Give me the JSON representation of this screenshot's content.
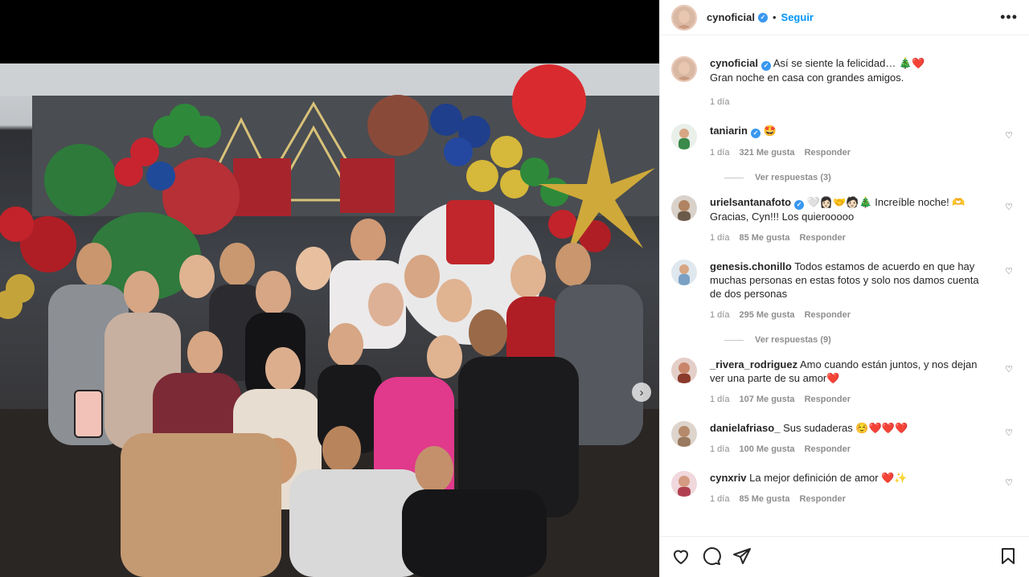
{
  "post": {
    "username": "cynoficial",
    "verified_mark": "✓",
    "dot": "•",
    "follow_label": "Seguir",
    "more_label": "•••",
    "caption_line1": "Así se siente la felicidad… 🎄❤️",
    "caption_line2": "Gran noche en casa con grandes amigos.",
    "time": "1 día"
  },
  "media": {
    "next_label": "›"
  },
  "comments": [
    {
      "user": "taniarin",
      "verified": true,
      "text": "🤩",
      "time": "1 día",
      "likes": "321 Me gusta",
      "reply": "Responder",
      "replies": "Ver respuestas (3)",
      "avatar_color": "#3a8a4a"
    },
    {
      "user": "urielsantanafoto",
      "verified": true,
      "text": "🤍👩🏻‍🤝‍🧑🏻🎄 Increíble noche! 🫶 Gracias, Cyn!!! Los quierooooo",
      "time": "1 día",
      "likes": "85 Me gusta",
      "reply": "Responder",
      "avatar_color": "#6b5a4a"
    },
    {
      "user": "genesis.chonillo",
      "verified": false,
      "text": "Todos estamos de acuerdo en que hay muchas personas en estas fotos y solo nos damos cuenta de dos personas",
      "time": "1 día",
      "likes": "295 Me gusta",
      "reply": "Responder",
      "replies": "Ver respuestas (9)",
      "avatar_color": "#7aa1c4"
    },
    {
      "user": "_rivera_rodriguez",
      "verified": false,
      "text": "Amo cuando están juntos, y nos dejan ver una parte de su amor❤️",
      "time": "1 día",
      "likes": "107 Me gusta",
      "reply": "Responder",
      "avatar_color": "#8a3a2a"
    },
    {
      "user": "danielafriaso_",
      "verified": false,
      "text": "Sus sudaderas ☺️❤️❤️❤️",
      "time": "1 día",
      "likes": "100 Me gusta",
      "reply": "Responder",
      "avatar_color": "#9a7a60"
    },
    {
      "user": "cynxriv",
      "verified": false,
      "text": "La mejor definición de amor ❤️✨",
      "time": "1 día",
      "likes": "85 Me gusta",
      "reply": "Responder",
      "avatar_color": "#b04050"
    }
  ],
  "icons": [
    "like-icon",
    "comment-icon",
    "share-icon",
    "save-icon",
    "heart-icon",
    "verified-icon",
    "chevron-right-icon",
    "more-icon"
  ],
  "colors": {
    "link": "#0095f6",
    "verified": "#3897f0",
    "text": "#262626",
    "muted": "#8e8e8e"
  }
}
